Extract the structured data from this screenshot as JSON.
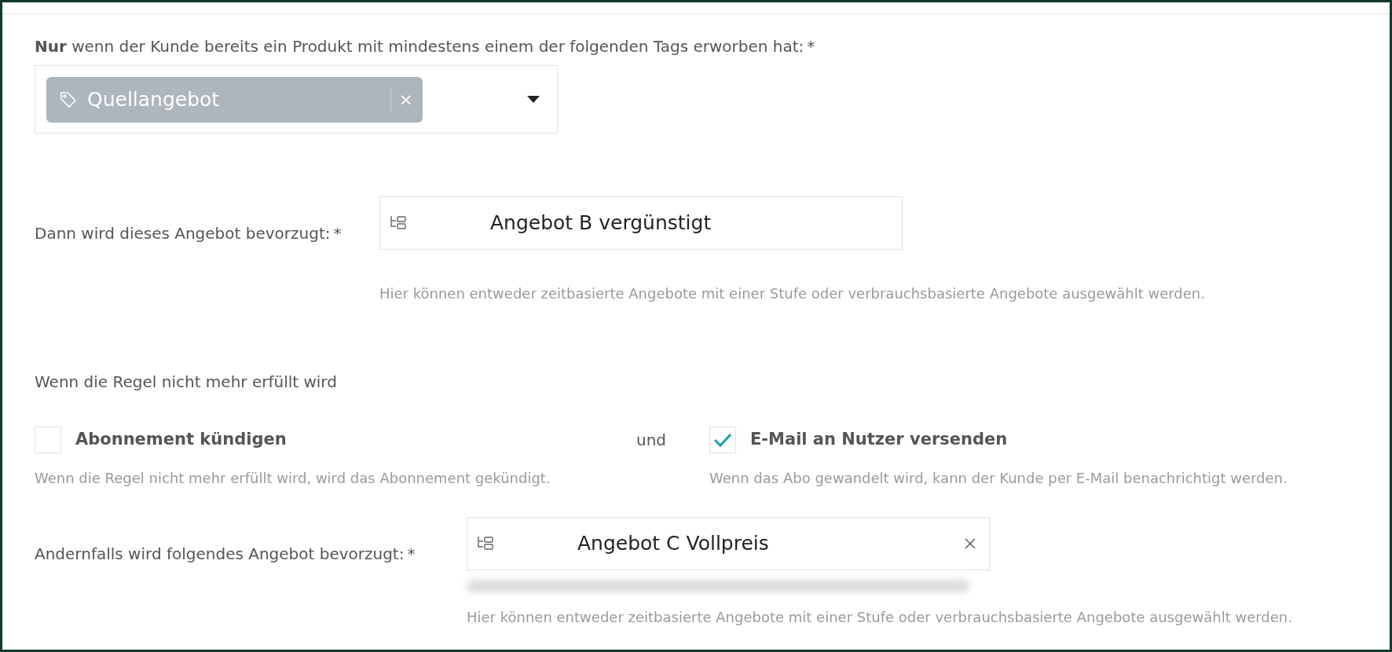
{
  "tag_condition": {
    "label": "**Nur** wenn der Kunde bereits ein Produkt mit mindestens einem der folgenden Tags erworben hat:",
    "required_mark": "*",
    "tags": [
      {
        "label": "Quellangebot",
        "remove": "×"
      }
    ]
  },
  "preferred_offer": {
    "label": "Dann wird dieses Angebot bevorzugt:",
    "required_mark": "*",
    "value": "Angebot B vergünstigt",
    "clearable": false,
    "help": "Hier können entweder zeitbasierte Angebote mit einer Stufe oder verbrauchsbasierte Angebote ausgewählt werden."
  },
  "rule_failure": {
    "heading": "Wenn die Regel nicht mehr erfüllt wird",
    "connector": "und",
    "options": [
      {
        "label": "Abonnement kündigen",
        "checked": false,
        "help": "Wenn die Regel nicht mehr erfüllt wird, wird das Abonnement gekündigt."
      },
      {
        "label": "E-Mail an Nutzer versenden",
        "checked": true,
        "help": "Wenn das Abo gewandelt wird, kann der Kunde per E-Mail benachrichtigt werden."
      }
    ]
  },
  "fallback_offer": {
    "label": "Andernfalls wird folgendes Angebot bevorzugt:",
    "required_mark": "*",
    "value": "Angebot C Vollpreis",
    "clearable": true,
    "help": "Hier können entweder zeitbasierte Angebote mit einer Stufe oder verbrauchsbasierte Angebote ausgewählt werden."
  }
}
